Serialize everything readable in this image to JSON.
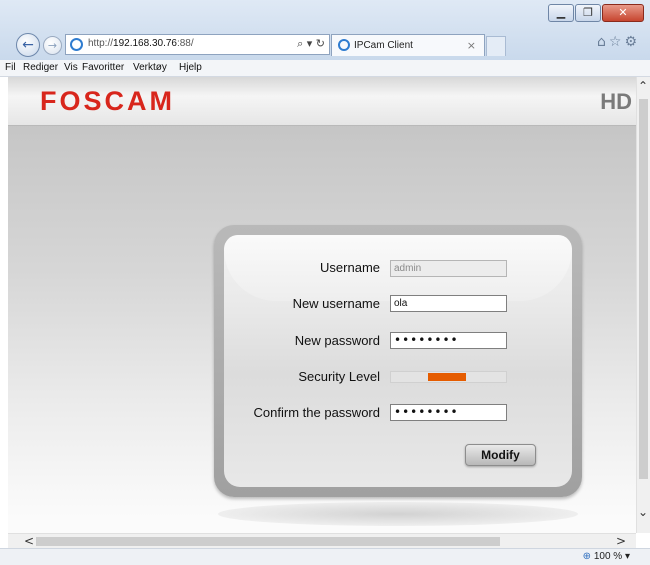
{
  "browser": {
    "address": {
      "url_prefix": "http://",
      "url_host": "192.168.30.76",
      "url_suffix": ":88/"
    },
    "address_tools": "⌕ ▾ ↻",
    "tab": {
      "label": "IPCam Client",
      "close": "×"
    },
    "window_controls": {
      "minimize": "▁",
      "restore": "❐",
      "close": "✕"
    },
    "menu": [
      "Fil",
      "Rediger",
      "Vis",
      "Favoritter",
      "Verktøy",
      "Hjelp"
    ],
    "zoom_label": "100 %",
    "zoom_icon": "zoom-icon"
  },
  "page": {
    "brand": "FOSCAM",
    "hd_badge": "HD",
    "accent_color": "#d8261c",
    "form": {
      "username_label": "Username",
      "username_value": "admin",
      "new_username_label": "New username",
      "new_username_value": "ola",
      "new_password_label": "New password",
      "new_password_value": "••••••••",
      "security_label": "Security Level",
      "security_level_fraction": 0.33,
      "security_color": "#e55c00",
      "confirm_label": "Confirm the password",
      "confirm_value": "••••••••",
      "modify_button": "Modify"
    }
  }
}
